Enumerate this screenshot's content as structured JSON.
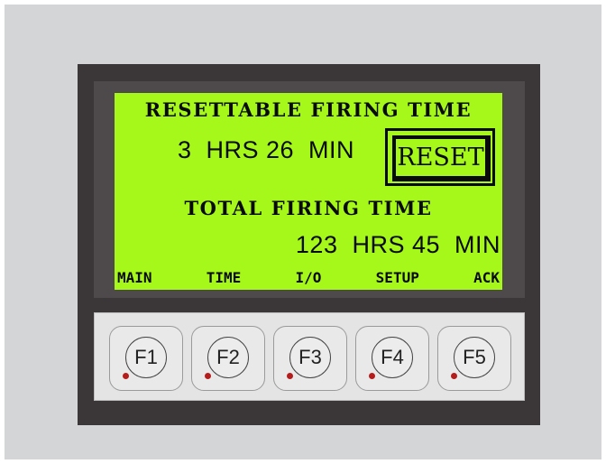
{
  "display": {
    "resettable_title": "RESETTABLE FIRING TIME",
    "resettable_value": "3  HRS 26  MIN",
    "reset_button": "RESET",
    "total_title": "TOTAL FIRING TIME",
    "total_value": "123  HRS 45  MIN",
    "menu": [
      "MAIN",
      "TIME",
      "I/O",
      "SETUP",
      "ACK"
    ]
  },
  "keys": [
    "F1",
    "F2",
    "F3",
    "F4",
    "F5"
  ],
  "colors": {
    "lcd_background": "#a6f81a",
    "bezel": "#3b3637",
    "led": "#b51d1d"
  }
}
